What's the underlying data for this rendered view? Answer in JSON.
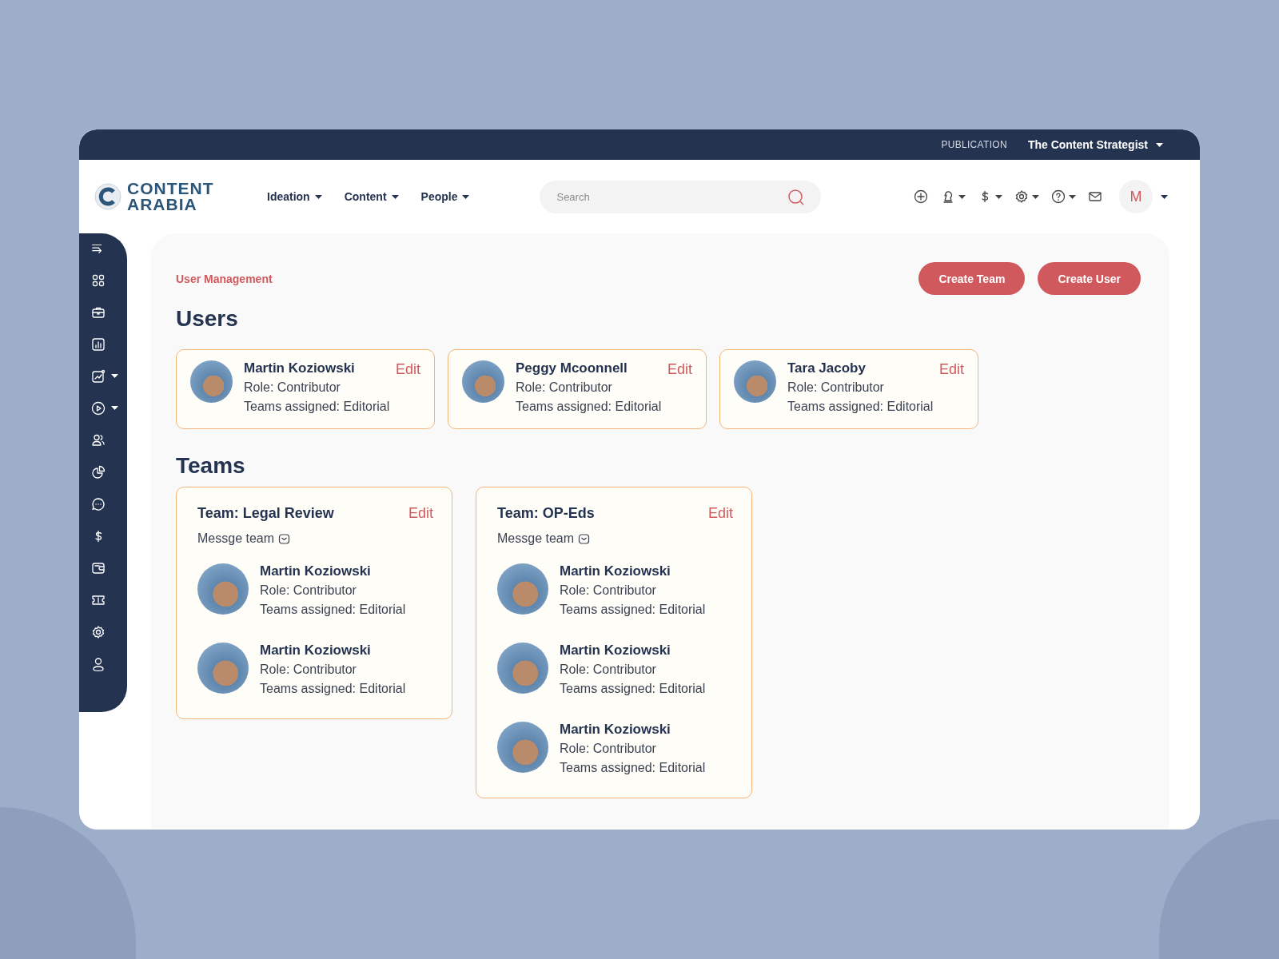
{
  "publication": {
    "label": "PUBLICATION",
    "value": "The Content Strategist"
  },
  "logo": {
    "line_1": "CONTENT",
    "line_2": "ARABIA"
  },
  "nav": [
    {
      "label": "Ideation"
    },
    {
      "label": "Content"
    },
    {
      "label": "People"
    }
  ],
  "search": {
    "placeholder": "Search"
  },
  "toolbar": [
    {
      "kind": "plus",
      "dropdown": false
    },
    {
      "kind": "chess",
      "dropdown": true
    },
    {
      "kind": "dollar",
      "dropdown": true
    },
    {
      "kind": "gear",
      "dropdown": true
    },
    {
      "kind": "help",
      "dropdown": true
    },
    {
      "kind": "mail",
      "dropdown": false
    }
  ],
  "account": {
    "initial": "M"
  },
  "sidebar": {
    "items": [
      {
        "kind": "collapse",
        "dropdown": false
      },
      {
        "kind": "grid",
        "dropdown": false
      },
      {
        "kind": "briefcase",
        "dropdown": false
      },
      {
        "kind": "chart",
        "dropdown": false
      },
      {
        "kind": "trend",
        "dropdown": true
      },
      {
        "kind": "play",
        "dropdown": true
      },
      {
        "kind": "users",
        "dropdown": false
      },
      {
        "kind": "pie",
        "dropdown": false
      },
      {
        "kind": "chat",
        "dropdown": false
      },
      {
        "kind": "dollar",
        "dropdown": false
      },
      {
        "kind": "wallet",
        "dropdown": false
      },
      {
        "kind": "ticket",
        "dropdown": false
      },
      {
        "kind": "gear",
        "dropdown": false
      },
      {
        "kind": "user",
        "dropdown": false
      }
    ]
  },
  "breadcrumb": "User Management",
  "buttons": [
    {
      "label": "Create Team"
    },
    {
      "label": "Create User"
    }
  ],
  "users": {
    "title": "Users",
    "cards": [
      {
        "name": "Martin Koziowski",
        "role": "Role: Contributor",
        "teams": "Teams assigned: Editorial",
        "action": "Edit"
      },
      {
        "name": "Peggy Mcoonnell",
        "role": "Role: Contributor",
        "teams": "Teams assigned: Editorial",
        "action": "Edit"
      },
      {
        "name": "Tara Jacoby",
        "role": "Role: Contributor",
        "teams": "Teams assigned: Editorial",
        "action": "Edit"
      }
    ]
  },
  "teams": {
    "title": "Teams",
    "cards": [
      {
        "name": "Team: Legal Review",
        "action": "Edit",
        "message": "Messge team",
        "members": [
          {
            "name": "Martin Koziowski",
            "role": "Role: Contributor",
            "teams": "Teams assigned: Editorial"
          },
          {
            "name": "Martin Koziowski",
            "role": "Role: Contributor",
            "teams": "Teams assigned: Editorial"
          }
        ]
      },
      {
        "name": "Team: OP-Eds",
        "action": "Edit",
        "message": "Messge team",
        "members": [
          {
            "name": "Martin Koziowski",
            "role": "Role: Contributor",
            "teams": "Teams assigned: Editorial"
          },
          {
            "name": "Martin Koziowski",
            "role": "Role: Contributor",
            "teams": "Teams assigned: Editorial"
          },
          {
            "name": "Martin Koziowski",
            "role": "Role: Contributor",
            "teams": "Teams assigned: Editorial"
          }
        ]
      }
    ]
  }
}
